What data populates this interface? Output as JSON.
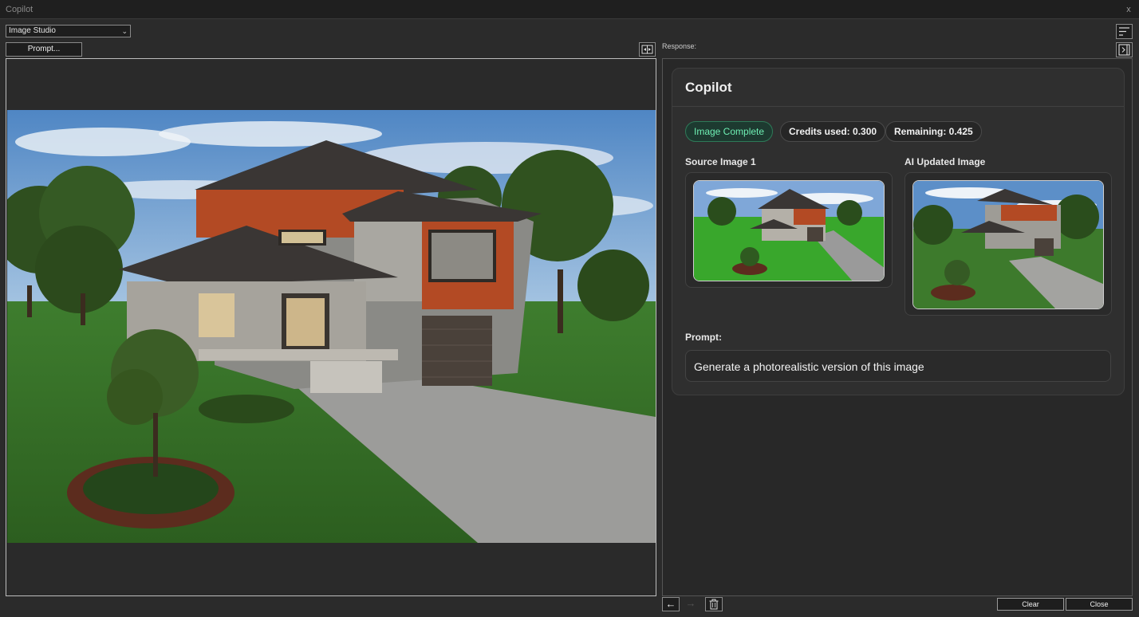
{
  "window": {
    "title": "Copilot",
    "close_glyph": "x"
  },
  "toolbar": {
    "mode": "Image Studio",
    "prompt_button": "Prompt..."
  },
  "response": {
    "label": "Response:",
    "card_title": "Copilot",
    "status": "Image Complete",
    "credits_used": "Credits used: 0.300",
    "remaining": "Remaining: 0.425",
    "source_label": "Source Image 1",
    "updated_label": "AI Updated Image",
    "prompt_label": "Prompt:",
    "prompt_text": "Generate a photorealistic version of this image"
  },
  "footer": {
    "clear": "Clear",
    "close": "Close",
    "back_glyph": "←",
    "forward_glyph": "→"
  },
  "icons": [
    "close-icon",
    "chevron-down-icon",
    "swap-panels-icon",
    "sort-lines-icon",
    "collapse-panel-icon",
    "arrow-left-icon",
    "arrow-right-icon",
    "trash-icon"
  ],
  "colors": {
    "accent_green": "#6ff0b4",
    "status_bg": "#1d3a30",
    "background": "#2b2b2b"
  }
}
